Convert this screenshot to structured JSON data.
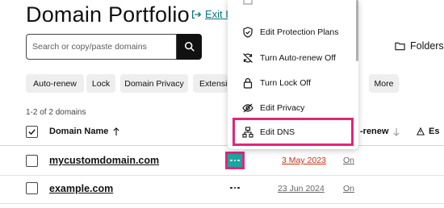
{
  "header": {
    "title": "Domain Portfolio",
    "exit_label": "Exit I"
  },
  "search": {
    "placeholder": "Search or copy/paste domains",
    "value": ""
  },
  "folders_label": "Folders",
  "filters": [
    "Auto-renew",
    "Lock",
    "Domain Privacy",
    "Extensio",
    "More"
  ],
  "count_text": "1-2 of 2 domains",
  "table": {
    "columns": {
      "domain_name": "Domain Name",
      "auto_renew": "-renew",
      "expires": "Es"
    },
    "rows": [
      {
        "domain": "mycustomdomain.com",
        "expires": "3 May 2023",
        "auto_renew": "On"
      },
      {
        "domain": "example.com",
        "expires": "23 Jun 2024",
        "auto_renew": "On"
      }
    ]
  },
  "menu": {
    "items": [
      {
        "label": "Edit Protection Plans",
        "icon": "shield-check-icon"
      },
      {
        "label": "Turn Auto-renew Off",
        "icon": "renew-off-icon"
      },
      {
        "label": "Turn Lock Off",
        "icon": "lock-icon"
      },
      {
        "label": "Edit Privacy",
        "icon": "eye-off-icon"
      },
      {
        "label": "Edit DNS",
        "icon": "dns-icon"
      }
    ]
  },
  "colors": {
    "highlight": "#e0267c",
    "teal": "#1aa6a0",
    "expired_red": "#c8311b",
    "link_teal": "#09757a"
  }
}
